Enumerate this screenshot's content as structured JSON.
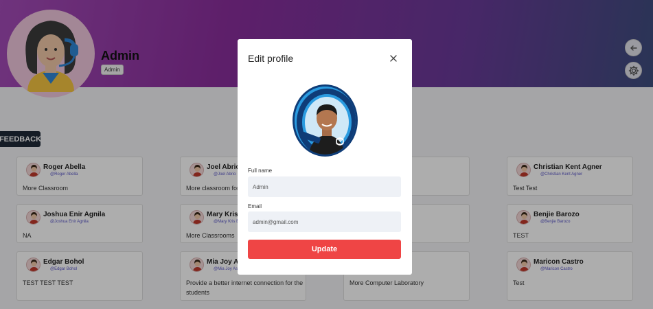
{
  "header": {
    "name": "Admin",
    "role_badge": "Admin"
  },
  "feedback_label": "FEEDBACK",
  "cards": [
    {
      "name": "Roger Abella",
      "handle": "@Roger Abella",
      "message": "More Classroom"
    },
    {
      "name": "Joel Abrio",
      "handle": "@Joel Abrio",
      "message": "More classroom for"
    },
    {
      "name": "",
      "handle": "",
      "message": ""
    },
    {
      "name": "Christian Kent Agner",
      "handle": "@Christian Kent Agner",
      "message": "Test Test"
    },
    {
      "name": "Joshua Enir Agnila",
      "handle": "@Joshua Enir Agnila",
      "message": "NA"
    },
    {
      "name": "Mary Kris E",
      "handle": "@Mary Kris E",
      "message": "More Classrooms"
    },
    {
      "name": "",
      "handle": "",
      "message": ""
    },
    {
      "name": "Benjie Barozo",
      "handle": "@Benjie Barozo",
      "message": "TEST"
    },
    {
      "name": "Edgar Bohol",
      "handle": "@Edgar Bohol",
      "message": "TEST TEST TEST"
    },
    {
      "name": "Mia Joy As",
      "handle": "@Mia Joy As",
      "message": "Provide a better internet connection for the students"
    },
    {
      "name": "",
      "handle": "",
      "message": "More Computer Laboratory"
    },
    {
      "name": "Maricon Castro",
      "handle": "@Maricon Castro",
      "message": "Test"
    }
  ],
  "modal": {
    "title": "Edit profile",
    "full_name_label": "Full name",
    "full_name_value": "Admin",
    "email_label": "Email",
    "email_value": "admin@gmail.com",
    "update_label": "Update"
  },
  "icons": {
    "back": "arrow-left-icon",
    "settings": "gear-icon",
    "close": "close-icon"
  },
  "colors": {
    "accent": "#ef4545",
    "feedback_bg": "#1f2a38",
    "handle": "#5a56c8"
  }
}
